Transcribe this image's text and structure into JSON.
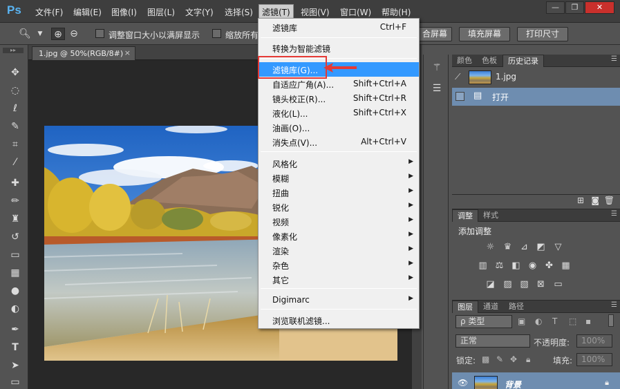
{
  "app": {
    "logo": "Ps"
  },
  "menubar": {
    "items": [
      "文件(F)",
      "编辑(E)",
      "图像(I)",
      "图层(L)",
      "文字(Y)",
      "选择(S)",
      "滤镜(T)",
      "视图(V)",
      "窗口(W)",
      "帮助(H)"
    ],
    "window_buttons": {
      "minimize": "—",
      "restore": "❐",
      "close": "✕"
    }
  },
  "options": {
    "resize_windows": "调整窗口大小以满屏显示",
    "zoom_all": "缩放所有",
    "fill_screen_cut": "合屏幕",
    "fill_screen": "填充屏幕",
    "print_size": "打印尺寸"
  },
  "document": {
    "tab": "1.jpg @ 50%(RGB/8#)",
    "close": "×"
  },
  "filter_menu": {
    "items": [
      {
        "label": "滤镜库",
        "shortcut": "Ctrl+F"
      },
      {
        "label": "转换为智能滤镜"
      },
      {
        "label": "滤镜库(G)..."
      },
      {
        "label": "自适应广角(A)...",
        "shortcut": "Shift+Ctrl+A"
      },
      {
        "label": "镜头校正(R)...",
        "shortcut": "Shift+Ctrl+R"
      },
      {
        "label": "液化(L)...",
        "shortcut": "Shift+Ctrl+X"
      },
      {
        "label": "油画(O)..."
      },
      {
        "label": "消失点(V)...",
        "shortcut": "Alt+Ctrl+V"
      },
      {
        "label": "风格化"
      },
      {
        "label": "模糊"
      },
      {
        "label": "扭曲"
      },
      {
        "label": "锐化"
      },
      {
        "label": "视频"
      },
      {
        "label": "像素化"
      },
      {
        "label": "渲染"
      },
      {
        "label": "杂色"
      },
      {
        "label": "其它"
      },
      {
        "label": "Digimarc"
      },
      {
        "label": "浏览联机滤镜..."
      }
    ],
    "submenu_arrow": "▶"
  },
  "history_panel": {
    "tabs": [
      "颜色",
      "色板",
      "历史记录"
    ],
    "snapshot": "1.jpg",
    "state": "打开"
  },
  "adjust_panel": {
    "tabs": [
      "调整",
      "样式"
    ],
    "title": "添加调整"
  },
  "layers_panel": {
    "tabs": [
      "图层",
      "通道",
      "路径"
    ],
    "filter_label": "ρ 类型",
    "blend_mode": "正常",
    "opacity_label": "不透明度:",
    "opacity_value": "100%",
    "lock_label": "锁定:",
    "fill_label": "填充:",
    "fill_value": "100%",
    "layer_name": "背景"
  },
  "colors": {
    "highlight": "#3399ff",
    "annotation": "#e53935",
    "selected_row": "#6e8db0"
  }
}
